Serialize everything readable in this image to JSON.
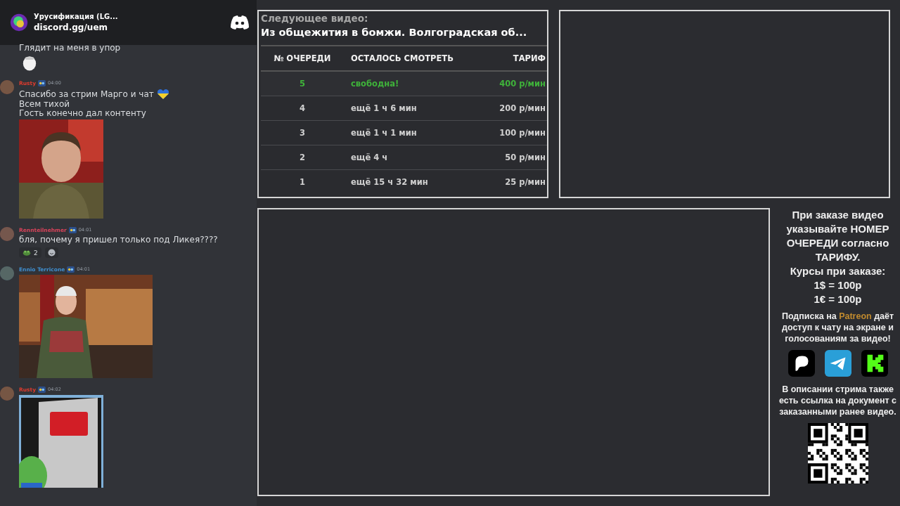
{
  "discord": {
    "server_name": "Урусификация (LG...",
    "invite": "discord.gg/uem"
  },
  "chat": [
    {
      "kind": "continued",
      "lines": [
        "Глядит на меня в упор"
      ],
      "sticker": true
    },
    {
      "kind": "message",
      "author": "Rusty",
      "color": "#e03b2e",
      "time": "04:00",
      "lines": [
        "Спасибо за стрим Марго и чат",
        "Всем тихой",
        "Гость конечно дал контенту"
      ]
    },
    {
      "kind": "message",
      "author": "Rennteilnehmer",
      "color": "#d9435a",
      "time": "04:01",
      "lines": [
        "бля, почему я пришел только под Ликея????"
      ],
      "reactions": [
        {
          "count": "2"
        }
      ]
    },
    {
      "kind": "message",
      "author": "Ennio Terricone",
      "color": "#3f8fd0",
      "time": "04:01"
    },
    {
      "kind": "message",
      "author": "Rusty",
      "color": "#e03b2e",
      "time": "04:02"
    }
  ],
  "queue": {
    "label": "Следующее видео:",
    "title": "Из общежития в бомжи. Волгоградская об...",
    "columns": [
      "№ ОЧЕРЕДИ",
      "ОСТАЛОСЬ СМОТРЕТЬ",
      "ТАРИФ"
    ],
    "rows": [
      {
        "number": "5",
        "remaining": "свободна!",
        "rate": "400 р/мин",
        "free": true
      },
      {
        "number": "4",
        "remaining": "ещё 1 ч 6 мин",
        "rate": "200 р/мин",
        "free": false
      },
      {
        "number": "3",
        "remaining": "ещё 1 ч 1 мин",
        "rate": "100 р/мин",
        "free": false
      },
      {
        "number": "2",
        "remaining": "ещё 4 ч",
        "rate": "50 р/мин",
        "free": false
      },
      {
        "number": "1",
        "remaining": "ещё 15 ч 32 мин",
        "rate": "25 р/мин",
        "free": false
      }
    ]
  },
  "info": {
    "order_note": "При заказе видео указывайте НОМЕР ОЧЕРЕДИ согласно ТАРИФУ.",
    "rates_title": "Курсы при заказе:",
    "rates": [
      "1$ = 100р",
      "1€ = 100р"
    ],
    "subscription": {
      "before": "Подписка на ",
      "highlight": "Patreon",
      "after": " даёт доступ к чату на экране и голосованиям за видео!"
    },
    "description_note": "В описании стрима также есть ссылка на документ с заказанными ранее видео."
  }
}
